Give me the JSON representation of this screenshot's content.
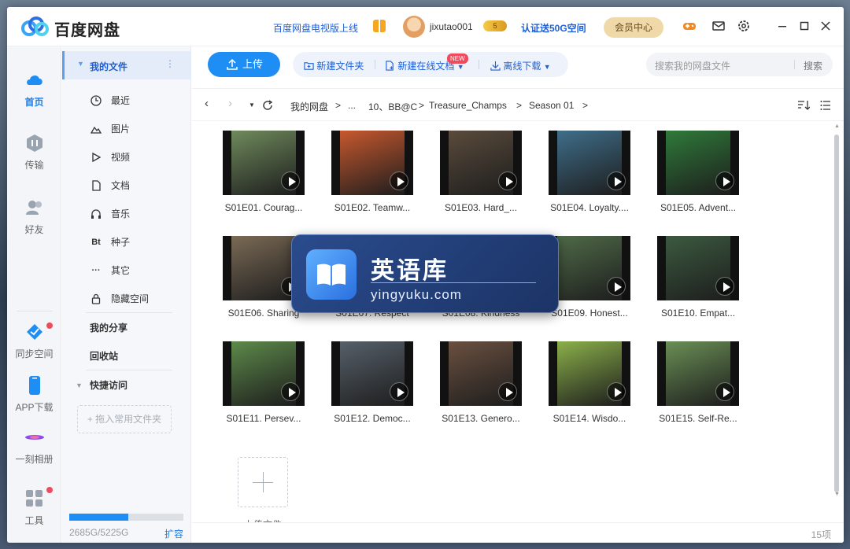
{
  "app": {
    "title": "百度网盘",
    "tv_link": "百度网盘电视版上线",
    "username": "jixutao001",
    "vip_badge": "5",
    "verify_link": "认证送50G空间",
    "member_center": "会员中心"
  },
  "nav": {
    "home": "首页",
    "transfer": "传输",
    "friends": "好友",
    "sync": "同步空间",
    "app_download": "APP下载",
    "moment": "一刻相册",
    "tools": "工具"
  },
  "filenav": {
    "my_files": "我的文件",
    "recent": "最近",
    "images": "图片",
    "videos": "视频",
    "docs": "文档",
    "music": "音乐",
    "torrents": "种子",
    "others": "其它",
    "hidden": "隐藏空间",
    "my_share": "我的分享",
    "recycle": "回收站",
    "quick_access": "快捷访问",
    "drop_hint": "+ 拖入常用文件夹",
    "quota": "2685G/5225G",
    "quota_fraction": 0.514,
    "expand": "扩容"
  },
  "toolbar": {
    "upload": "上传",
    "new_folder": "新建文件夹",
    "new_doc": "新建在线文档",
    "new_tag": "NEW",
    "offline_download": "离线下载",
    "search_placeholder": "搜索我的网盘文件",
    "search_button": "搜索"
  },
  "breadcrumb": {
    "root": "我的网盘",
    "ellipsis": "...",
    "c1": "10、BB@C",
    "c2": "Treasure_Champs",
    "c3": "Season 01"
  },
  "files": [
    {
      "name": "S01E01. Courag...",
      "color": "#6f8a5c"
    },
    {
      "name": "S01E02. Teamw...",
      "color": "#c7582e"
    },
    {
      "name": "S01E03. Hard_...",
      "color": "#5a4b3c"
    },
    {
      "name": "S01E04. Loyalty....",
      "color": "#3f6e8a"
    },
    {
      "name": "S01E05. Advent...",
      "color": "#2f7a3a"
    },
    {
      "name": "S01E06. Sharing",
      "color": "#7a6a55"
    },
    {
      "name": "S01E07. Respect",
      "color": "#8c7560"
    },
    {
      "name": "S01E08. Kindness",
      "color": "#4a6b4a"
    },
    {
      "name": "S01E09. Honest...",
      "color": "#4f6a48"
    },
    {
      "name": "S01E10. Empat...",
      "color": "#3c5a40"
    },
    {
      "name": "S01E11. Persev...",
      "color": "#5d8a4a"
    },
    {
      "name": "S01E12. Democ...",
      "color": "#56606a"
    },
    {
      "name": "S01E13. Genero...",
      "color": "#6a5040"
    },
    {
      "name": "S01E14. Wisdo...",
      "color": "#8bb04a"
    },
    {
      "name": "S01E15. Self-Re...",
      "color": "#6a8f55"
    }
  ],
  "add_file": "上传文件",
  "item_count": "15项",
  "overlay": {
    "title": "英语库",
    "url": "yingyuku.com"
  }
}
